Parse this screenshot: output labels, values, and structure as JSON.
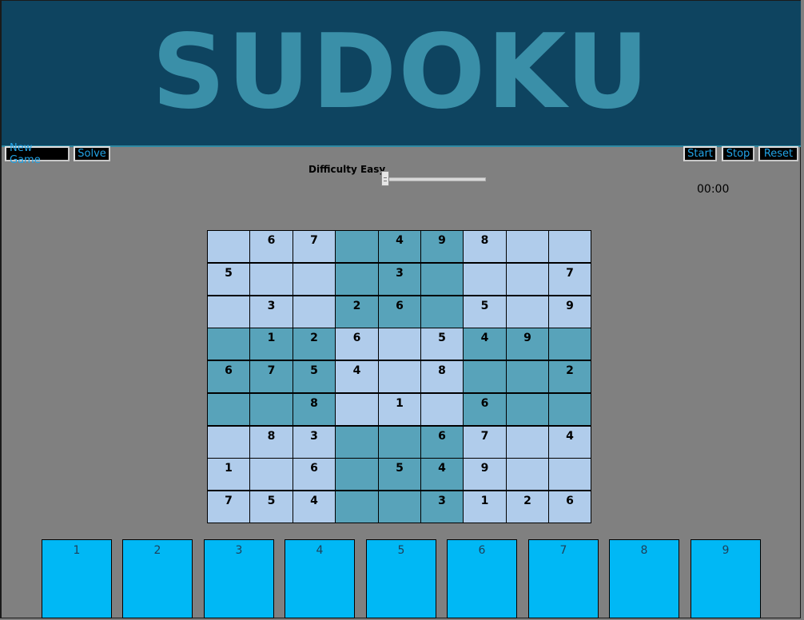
{
  "header": {
    "title": "SUDOKU"
  },
  "toolbar": {
    "new_game": "New Game",
    "solve": "Solve",
    "start": "Start",
    "stop": "Stop",
    "reset": "Reset"
  },
  "difficulty": {
    "label": "Difficulty Easy",
    "level": 0
  },
  "timer": {
    "value": "00:00"
  },
  "board": {
    "rows": [
      [
        "",
        "6",
        "7",
        "",
        "4",
        "9",
        "8",
        "",
        ""
      ],
      [
        "5",
        "",
        "",
        "",
        "3",
        "",
        "",
        "",
        "7"
      ],
      [
        "",
        "3",
        "",
        "2",
        "6",
        "",
        "5",
        "",
        "9"
      ],
      [
        "",
        "1",
        "2",
        "6",
        "",
        "5",
        "4",
        "9",
        ""
      ],
      [
        "6",
        "7",
        "5",
        "4",
        "",
        "8",
        "",
        "",
        "2"
      ],
      [
        "",
        "",
        "8",
        "",
        "1",
        "",
        "6",
        "",
        ""
      ],
      [
        "",
        "8",
        "3",
        "",
        "",
        "6",
        "7",
        "",
        "4"
      ],
      [
        "1",
        "",
        "6",
        "",
        "5",
        "4",
        "9",
        "",
        ""
      ],
      [
        "7",
        "5",
        "4",
        "",
        "",
        "3",
        "1",
        "2",
        "6"
      ]
    ]
  },
  "number_pad": [
    "1",
    "2",
    "3",
    "4",
    "5",
    "6",
    "7",
    "8",
    "9"
  ],
  "colors": {
    "header_bg": "#0e4460",
    "title": "#3a8fa8",
    "cell_light": "#b0cceb",
    "cell_dark": "#58a3ba",
    "tile": "#00b8f5",
    "button_text": "#22a3e6"
  }
}
